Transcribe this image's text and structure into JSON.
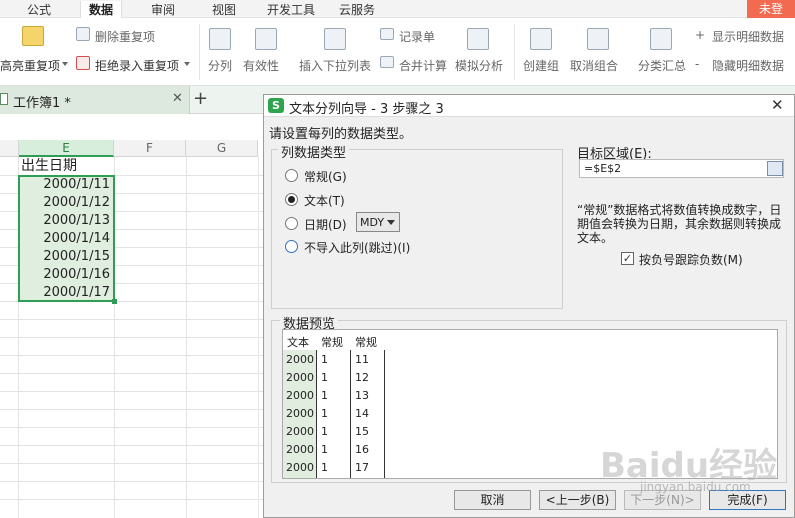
{
  "ribbon_tabs": [
    "公式",
    "数据",
    "审阅",
    "视图",
    "开发工具",
    "云服务"
  ],
  "unlogged": "未登",
  "ribbon": {
    "highlight_dup": "高亮重复项",
    "delete_dup": "删除重复项",
    "reject_dup": "拒绝录入重复项",
    "split_col": "分列",
    "validity": "有效性",
    "insert_dropdown": "插入下拉列表",
    "record_form": "记录单",
    "consolidate": "合并计算",
    "simulate": "模拟分析",
    "create_group": "创建组",
    "ungroup": "取消组合",
    "subtotal": "分类汇总",
    "show_detail": "显示明细数据",
    "hide_detail": "隐藏明细数据"
  },
  "doc_tab": "工作簿1 *",
  "sheet": {
    "col_e": "E",
    "col_f": "F",
    "col_g": "G",
    "header": "出生日期",
    "dates": [
      "2000/1/11",
      "2000/1/12",
      "2000/1/13",
      "2000/1/14",
      "2000/1/15",
      "2000/1/16",
      "2000/1/17"
    ]
  },
  "dialog": {
    "title": "文本分列向导 - 3 步骤之 3",
    "instruction": "请设置每列的数据类型。",
    "group_label": "列数据类型",
    "opt_general": "常规(G)",
    "opt_text": "文本(T)",
    "opt_date": "日期(D)",
    "date_format": "MDY",
    "opt_skip": "不导入此列(跳过)(I)",
    "target_label": "目标区域(E):",
    "target_value": "=$E$2",
    "note": "“常规”数据格式将数值转换成数字，日期值会转换为日期，其余数据则转换成文本。",
    "track_negative": "按负号跟踪负数(M)",
    "preview_label": "数据预览",
    "preview_headers": [
      "文本",
      "常规",
      "常规"
    ],
    "preview_rows": [
      [
        "2000",
        "1",
        "11"
      ],
      [
        "2000",
        "1",
        "12"
      ],
      [
        "2000",
        "1",
        "13"
      ],
      [
        "2000",
        "1",
        "14"
      ],
      [
        "2000",
        "1",
        "15"
      ],
      [
        "2000",
        "1",
        "16"
      ],
      [
        "2000",
        "1",
        "17"
      ]
    ],
    "btn_cancel": "取消",
    "btn_prev": "<上一步(B)",
    "btn_next": "下一步(N)>",
    "btn_finish": "完成(F)"
  },
  "watermark": "Baidu经验",
  "watermark_url": "jingyan.baidu.com",
  "colors": {
    "accent": "#2e9e55",
    "selection": "#dfeedf",
    "unlogged": "#f26a4f"
  }
}
